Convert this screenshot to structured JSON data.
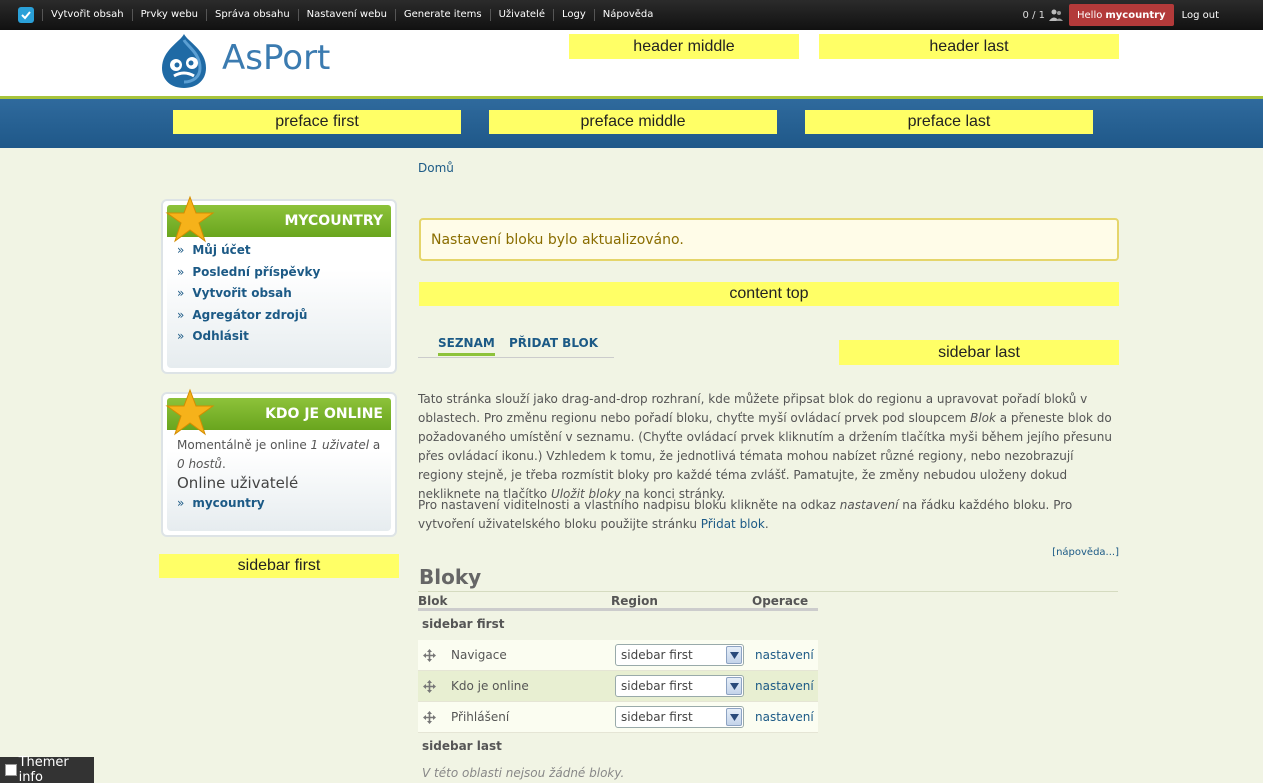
{
  "toolbar": {
    "menu": [
      "Vytvořit obsah",
      "Prvky webu",
      "Správa obsahu",
      "Nastavení webu",
      "Generate items",
      "Uživatelé",
      "Logy",
      "Nápověda"
    ],
    "user_count": "0 / 1",
    "hello_prefix": "Hello",
    "hello_user": "mycountry",
    "logout": "Log out"
  },
  "header": {
    "site_name": "AsPort",
    "region_middle": "header middle",
    "region_last": "header last"
  },
  "preface": {
    "first": "preface first",
    "middle": "preface middle",
    "last": "preface last"
  },
  "sidebar": {
    "block1": {
      "title": "MYCOUNTRY",
      "items": [
        "Můj účet",
        "Poslední příspěvky",
        "Vytvořit obsah",
        "Agregátor zdrojů",
        "Odhlásit"
      ]
    },
    "block2": {
      "title": "KDO JE ONLINE",
      "text_a": "Momentálně je online ",
      "text_b": "1 uživatel",
      "text_c": " a ",
      "text_d": "0 hostů",
      "text_e": ".",
      "subtitle": "Online uživatelé",
      "user": "mycountry"
    },
    "region_first": "sidebar first"
  },
  "content": {
    "breadcrumb": "Domů",
    "status": "Nastavení bloku bylo aktualizováno.",
    "region_top": "content top",
    "region_sidebar_last": "sidebar last",
    "tabs": [
      "SEZNAM",
      "PŘIDAT BLOK"
    ],
    "desc1_a": "Tato stránka slouží jako drag-and-drop rozhraní, kde můžete připsat blok do regionu a upravovat pořadí bloků v oblastech. Pro změnu regionu nebo pořadí bloku, chyťte myší ovládací prvek pod sloupcem ",
    "desc1_b": "Blok",
    "desc1_c": " a přeneste blok do požadovaného umístění v seznamu. (Chyťte ovládací prvek kliknutím a držením tlačítka myši během jejího přesunu přes ovládací ikonu.) Vzhledem k tomu, že jednotlivá témata mohou nabízet různé regiony, nebo nezobrazují regiony stejně, je třeba rozmístit bloky pro každé téma zvlášť. Pamatujte, že změny nebudou uloženy dokud nekliknete na tlačítko ",
    "desc1_d": "Uložit bloky",
    "desc1_e": " na konci stránky.",
    "desc2_a": "Pro nastavení viditelnosti a vlastního nadpisu bloku klikněte na odkaz ",
    "desc2_b": "nastavení",
    "desc2_c": " na řádku každého bloku. Pro vytvoření uživatelského bloku použijte stránku ",
    "desc2_d": "Přidat blok",
    "desc2_e": ".",
    "help": "[nápověda...]",
    "blocks_title": "Bloky",
    "table": {
      "headers": [
        "Blok",
        "Region",
        "Operace"
      ],
      "region1": "sidebar first",
      "rows": [
        {
          "name": "Navigace",
          "region": "sidebar first",
          "op": "nastavení"
        },
        {
          "name": "Kdo je online",
          "region": "sidebar first",
          "op": "nastavení"
        },
        {
          "name": "Přihlášení",
          "region": "sidebar first",
          "op": "nastavení"
        }
      ],
      "region2": "sidebar last",
      "empty": "V této oblasti nejsou žádné bloky."
    }
  },
  "themer": "Themer info"
}
